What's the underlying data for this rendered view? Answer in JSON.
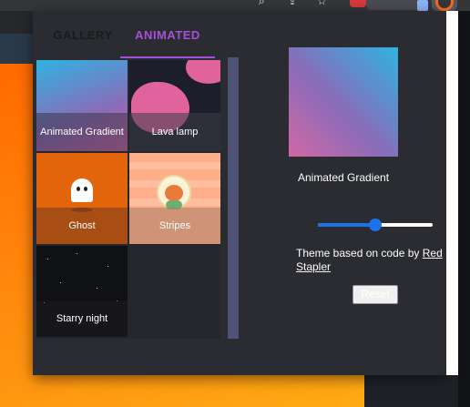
{
  "tabs": [
    {
      "label": "GALLERY",
      "active": false
    },
    {
      "label": "ANIMATED",
      "active": true
    }
  ],
  "themes": [
    {
      "label": "Animated Gradient"
    },
    {
      "label": "Lava lamp"
    },
    {
      "label": "Ghost"
    },
    {
      "label": "Stripes"
    },
    {
      "label": "Starry night"
    }
  ],
  "preview": {
    "label": "Animated Gradient",
    "speed_slider_value": 0.5
  },
  "credit": {
    "prefix": "Theme based on code by ",
    "link_text": "Red Stapler"
  },
  "reset_label": "Reset",
  "colors": {
    "accent": "#a64fd8",
    "slider": "#1a73e8",
    "panel_bg": "#2b2c31"
  }
}
